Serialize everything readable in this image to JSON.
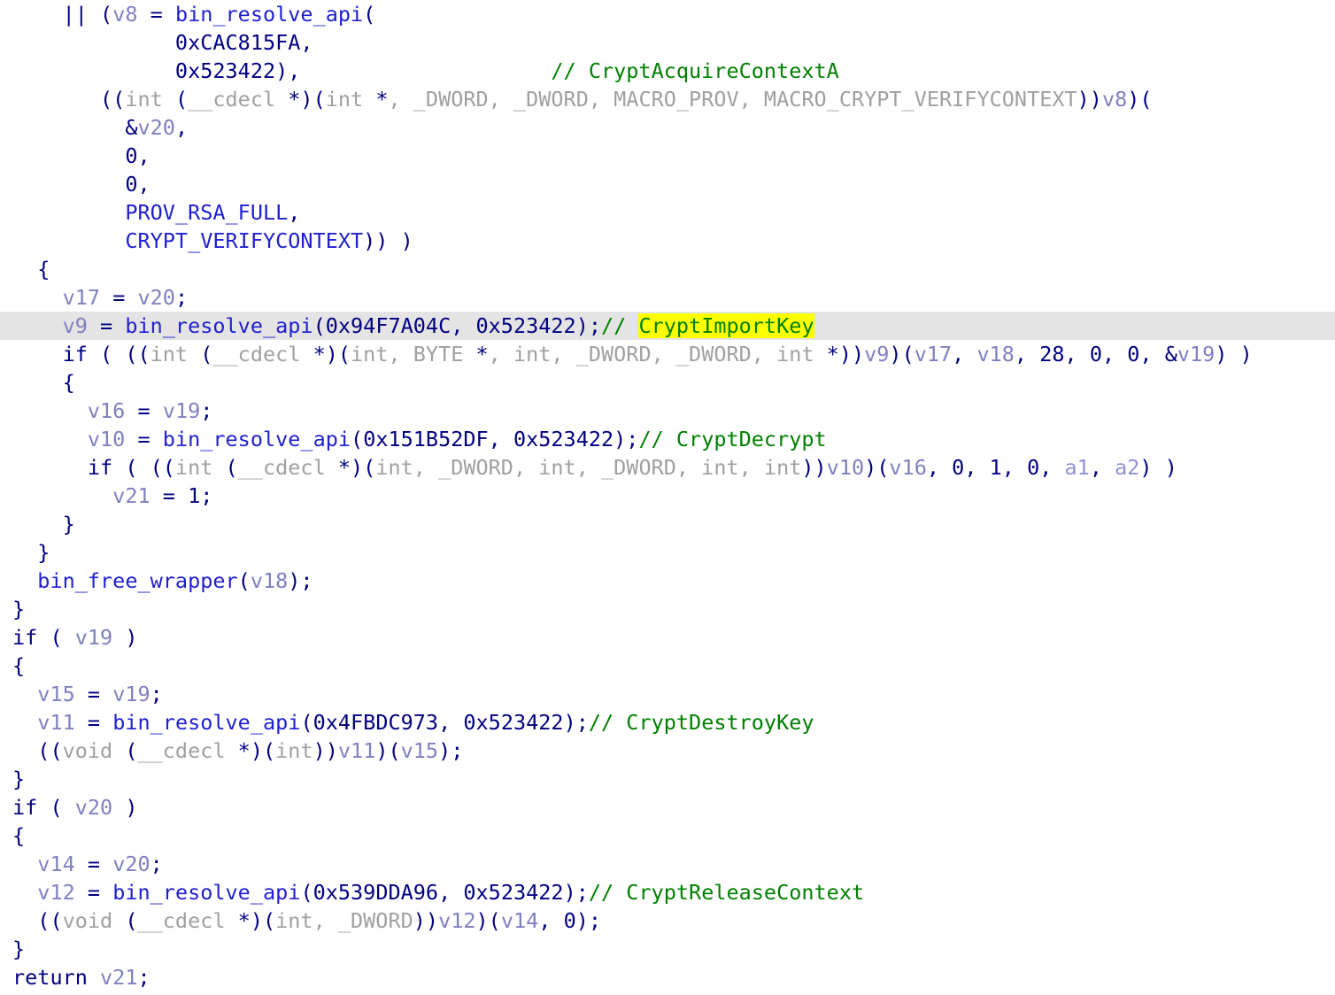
{
  "view": {
    "name": "ida-pseudocode-view",
    "background": "#ffffff",
    "current_line_background": "#e4e4e4",
    "highlight_background": "#ffff00",
    "font_size_px": 23.5,
    "line_height_px": 32
  },
  "colors": {
    "keyword": "#000080",
    "function": "#2020d0",
    "variable": "#8080c0",
    "argument": "#9090d8",
    "type": "#a0a0a0",
    "comment": "#008000",
    "macro": "#2020d0",
    "highlight_bg": "#ffff00",
    "current_line_bg": "#e4e4e4"
  },
  "lines": [
    {
      "index": 0,
      "current": false,
      "tokens": [
        {
          "cls": "t-punct",
          "text": "    || ("
        },
        {
          "cls": "t-var",
          "text": "v8"
        },
        {
          "cls": "t-punct",
          "text": " = "
        },
        {
          "cls": "t-fn",
          "text": "bin_resolve_api"
        },
        {
          "cls": "t-punct",
          "text": "("
        }
      ]
    },
    {
      "index": 1,
      "current": false,
      "tokens": [
        {
          "cls": "t-num",
          "text": "             0xCAC815FA,"
        }
      ]
    },
    {
      "index": 2,
      "current": false,
      "tokens": [
        {
          "cls": "t-num",
          "text": "             0x523422),"
        },
        {
          "cls": "t-cmt",
          "text": "                    // CryptAcquireContextA"
        }
      ]
    },
    {
      "index": 3,
      "current": false,
      "tokens": [
        {
          "cls": "t-punct",
          "text": "       (("
        },
        {
          "cls": "t-type",
          "text": "int"
        },
        {
          "cls": "t-punct",
          "text": " ("
        },
        {
          "cls": "t-type",
          "text": "__cdecl"
        },
        {
          "cls": "t-punct",
          "text": " *)("
        },
        {
          "cls": "t-type",
          "text": "int"
        },
        {
          "cls": "t-punct",
          "text": " *"
        },
        {
          "cls": "t-type",
          "text": ", _DWORD, _DWORD, MACRO_PROV, MACRO_CRYPT_VERIFYCONTEXT"
        },
        {
          "cls": "t-punct",
          "text": "))"
        },
        {
          "cls": "t-var",
          "text": "v8"
        },
        {
          "cls": "t-punct",
          "text": ")("
        }
      ]
    },
    {
      "index": 4,
      "current": false,
      "tokens": [
        {
          "cls": "t-punct",
          "text": "         &"
        },
        {
          "cls": "t-var",
          "text": "v20"
        },
        {
          "cls": "t-punct",
          "text": ","
        }
      ]
    },
    {
      "index": 5,
      "current": false,
      "tokens": [
        {
          "cls": "t-num",
          "text": "         0,"
        }
      ]
    },
    {
      "index": 6,
      "current": false,
      "tokens": [
        {
          "cls": "t-num",
          "text": "         0,"
        }
      ]
    },
    {
      "index": 7,
      "current": false,
      "tokens": [
        {
          "cls": "t-macro",
          "text": "         PROV_RSA_FULL"
        },
        {
          "cls": "t-punct",
          "text": ","
        }
      ]
    },
    {
      "index": 8,
      "current": false,
      "tokens": [
        {
          "cls": "t-macro",
          "text": "         CRYPT_VERIFYCONTEXT"
        },
        {
          "cls": "t-punct",
          "text": ")) )"
        }
      ]
    },
    {
      "index": 9,
      "current": false,
      "tokens": [
        {
          "cls": "t-punct",
          "text": "  {"
        }
      ]
    },
    {
      "index": 10,
      "current": false,
      "tokens": [
        {
          "cls": "t-var",
          "text": "    v17"
        },
        {
          "cls": "t-punct",
          "text": " = "
        },
        {
          "cls": "t-var",
          "text": "v20"
        },
        {
          "cls": "t-punct",
          "text": ";"
        }
      ]
    },
    {
      "index": 11,
      "current": true,
      "tokens": [
        {
          "cls": "t-var",
          "text": "    v9"
        },
        {
          "cls": "t-punct",
          "text": " = "
        },
        {
          "cls": "t-fn",
          "text": "bin_resolve_api"
        },
        {
          "cls": "t-punct",
          "text": "("
        },
        {
          "cls": "t-num",
          "text": "0x94F7A04C"
        },
        {
          "cls": "t-punct",
          "text": ", "
        },
        {
          "cls": "t-num",
          "text": "0x523422"
        },
        {
          "cls": "t-punct",
          "text": ");"
        },
        {
          "cls": "t-cmt",
          "text": "// "
        },
        {
          "cls": "t-hl",
          "text": "CryptImportKey"
        }
      ]
    },
    {
      "index": 12,
      "current": false,
      "tokens": [
        {
          "cls": "t-kw",
          "text": "    if"
        },
        {
          "cls": "t-punct",
          "text": " ( (("
        },
        {
          "cls": "t-type",
          "text": "int"
        },
        {
          "cls": "t-punct",
          "text": " ("
        },
        {
          "cls": "t-type",
          "text": "__cdecl"
        },
        {
          "cls": "t-punct",
          "text": " *)("
        },
        {
          "cls": "t-type",
          "text": "int, BYTE"
        },
        {
          "cls": "t-punct",
          "text": " *"
        },
        {
          "cls": "t-type",
          "text": ", int, _DWORD, _DWORD, int"
        },
        {
          "cls": "t-punct",
          "text": " *))"
        },
        {
          "cls": "t-var",
          "text": "v9"
        },
        {
          "cls": "t-punct",
          "text": ")("
        },
        {
          "cls": "t-var",
          "text": "v17"
        },
        {
          "cls": "t-punct",
          "text": ", "
        },
        {
          "cls": "t-var",
          "text": "v18"
        },
        {
          "cls": "t-punct",
          "text": ", "
        },
        {
          "cls": "t-num",
          "text": "28"
        },
        {
          "cls": "t-punct",
          "text": ", "
        },
        {
          "cls": "t-num",
          "text": "0"
        },
        {
          "cls": "t-punct",
          "text": ", "
        },
        {
          "cls": "t-num",
          "text": "0"
        },
        {
          "cls": "t-punct",
          "text": ", &"
        },
        {
          "cls": "t-var",
          "text": "v19"
        },
        {
          "cls": "t-punct",
          "text": ") )"
        }
      ]
    },
    {
      "index": 13,
      "current": false,
      "tokens": [
        {
          "cls": "t-punct",
          "text": "    {"
        }
      ]
    },
    {
      "index": 14,
      "current": false,
      "tokens": [
        {
          "cls": "t-var",
          "text": "      v16"
        },
        {
          "cls": "t-punct",
          "text": " = "
        },
        {
          "cls": "t-var",
          "text": "v19"
        },
        {
          "cls": "t-punct",
          "text": ";"
        }
      ]
    },
    {
      "index": 15,
      "current": false,
      "tokens": [
        {
          "cls": "t-var",
          "text": "      v10"
        },
        {
          "cls": "t-punct",
          "text": " = "
        },
        {
          "cls": "t-fn",
          "text": "bin_resolve_api"
        },
        {
          "cls": "t-punct",
          "text": "("
        },
        {
          "cls": "t-num",
          "text": "0x151B52DF"
        },
        {
          "cls": "t-punct",
          "text": ", "
        },
        {
          "cls": "t-num",
          "text": "0x523422"
        },
        {
          "cls": "t-punct",
          "text": ");"
        },
        {
          "cls": "t-cmt",
          "text": "// CryptDecrypt"
        }
      ]
    },
    {
      "index": 16,
      "current": false,
      "tokens": [
        {
          "cls": "t-kw",
          "text": "      if"
        },
        {
          "cls": "t-punct",
          "text": " ( (("
        },
        {
          "cls": "t-type",
          "text": "int"
        },
        {
          "cls": "t-punct",
          "text": " ("
        },
        {
          "cls": "t-type",
          "text": "__cdecl"
        },
        {
          "cls": "t-punct",
          "text": " *)("
        },
        {
          "cls": "t-type",
          "text": "int, _DWORD, int, _DWORD, int, int"
        },
        {
          "cls": "t-punct",
          "text": "))"
        },
        {
          "cls": "t-var",
          "text": "v10"
        },
        {
          "cls": "t-punct",
          "text": ")("
        },
        {
          "cls": "t-var",
          "text": "v16"
        },
        {
          "cls": "t-punct",
          "text": ", "
        },
        {
          "cls": "t-num",
          "text": "0"
        },
        {
          "cls": "t-punct",
          "text": ", "
        },
        {
          "cls": "t-num",
          "text": "1"
        },
        {
          "cls": "t-punct",
          "text": ", "
        },
        {
          "cls": "t-num",
          "text": "0"
        },
        {
          "cls": "t-punct",
          "text": ", "
        },
        {
          "cls": "t-arg",
          "text": "a1"
        },
        {
          "cls": "t-punct",
          "text": ", "
        },
        {
          "cls": "t-arg",
          "text": "a2"
        },
        {
          "cls": "t-punct",
          "text": ") )"
        }
      ]
    },
    {
      "index": 17,
      "current": false,
      "tokens": [
        {
          "cls": "t-var",
          "text": "        v21"
        },
        {
          "cls": "t-punct",
          "text": " = "
        },
        {
          "cls": "t-num",
          "text": "1"
        },
        {
          "cls": "t-punct",
          "text": ";"
        }
      ]
    },
    {
      "index": 18,
      "current": false,
      "tokens": [
        {
          "cls": "t-punct",
          "text": "    }"
        }
      ]
    },
    {
      "index": 19,
      "current": false,
      "tokens": [
        {
          "cls": "t-punct",
          "text": "  }"
        }
      ]
    },
    {
      "index": 20,
      "current": false,
      "tokens": [
        {
          "cls": "t-fn",
          "text": "  bin_free_wrapper"
        },
        {
          "cls": "t-punct",
          "text": "("
        },
        {
          "cls": "t-var",
          "text": "v18"
        },
        {
          "cls": "t-punct",
          "text": ");"
        }
      ]
    },
    {
      "index": 21,
      "current": false,
      "tokens": [
        {
          "cls": "t-punct",
          "text": "}"
        }
      ]
    },
    {
      "index": 22,
      "current": false,
      "tokens": [
        {
          "cls": "t-kw",
          "text": "if"
        },
        {
          "cls": "t-punct",
          "text": " ( "
        },
        {
          "cls": "t-var",
          "text": "v19"
        },
        {
          "cls": "t-punct",
          "text": " )"
        }
      ]
    },
    {
      "index": 23,
      "current": false,
      "tokens": [
        {
          "cls": "t-punct",
          "text": "{"
        }
      ]
    },
    {
      "index": 24,
      "current": false,
      "tokens": [
        {
          "cls": "t-var",
          "text": "  v15"
        },
        {
          "cls": "t-punct",
          "text": " = "
        },
        {
          "cls": "t-var",
          "text": "v19"
        },
        {
          "cls": "t-punct",
          "text": ";"
        }
      ]
    },
    {
      "index": 25,
      "current": false,
      "tokens": [
        {
          "cls": "t-var",
          "text": "  v11"
        },
        {
          "cls": "t-punct",
          "text": " = "
        },
        {
          "cls": "t-fn",
          "text": "bin_resolve_api"
        },
        {
          "cls": "t-punct",
          "text": "("
        },
        {
          "cls": "t-num",
          "text": "0x4FBDC973"
        },
        {
          "cls": "t-punct",
          "text": ", "
        },
        {
          "cls": "t-num",
          "text": "0x523422"
        },
        {
          "cls": "t-punct",
          "text": ");"
        },
        {
          "cls": "t-cmt",
          "text": "// CryptDestroyKey"
        }
      ]
    },
    {
      "index": 26,
      "current": false,
      "tokens": [
        {
          "cls": "t-punct",
          "text": "  (("
        },
        {
          "cls": "t-type",
          "text": "void"
        },
        {
          "cls": "t-punct",
          "text": " ("
        },
        {
          "cls": "t-type",
          "text": "__cdecl"
        },
        {
          "cls": "t-punct",
          "text": " *)("
        },
        {
          "cls": "t-type",
          "text": "int"
        },
        {
          "cls": "t-punct",
          "text": "))"
        },
        {
          "cls": "t-var",
          "text": "v11"
        },
        {
          "cls": "t-punct",
          "text": ")("
        },
        {
          "cls": "t-var",
          "text": "v15"
        },
        {
          "cls": "t-punct",
          "text": ");"
        }
      ]
    },
    {
      "index": 27,
      "current": false,
      "tokens": [
        {
          "cls": "t-punct",
          "text": "}"
        }
      ]
    },
    {
      "index": 28,
      "current": false,
      "tokens": [
        {
          "cls": "t-kw",
          "text": "if"
        },
        {
          "cls": "t-punct",
          "text": " ( "
        },
        {
          "cls": "t-var",
          "text": "v20"
        },
        {
          "cls": "t-punct",
          "text": " )"
        }
      ]
    },
    {
      "index": 29,
      "current": false,
      "tokens": [
        {
          "cls": "t-punct",
          "text": "{"
        }
      ]
    },
    {
      "index": 30,
      "current": false,
      "tokens": [
        {
          "cls": "t-var",
          "text": "  v14"
        },
        {
          "cls": "t-punct",
          "text": " = "
        },
        {
          "cls": "t-var",
          "text": "v20"
        },
        {
          "cls": "t-punct",
          "text": ";"
        }
      ]
    },
    {
      "index": 31,
      "current": false,
      "tokens": [
        {
          "cls": "t-var",
          "text": "  v12"
        },
        {
          "cls": "t-punct",
          "text": " = "
        },
        {
          "cls": "t-fn",
          "text": "bin_resolve_api"
        },
        {
          "cls": "t-punct",
          "text": "("
        },
        {
          "cls": "t-num",
          "text": "0x539DDA96"
        },
        {
          "cls": "t-punct",
          "text": ", "
        },
        {
          "cls": "t-num",
          "text": "0x523422"
        },
        {
          "cls": "t-punct",
          "text": ");"
        },
        {
          "cls": "t-cmt",
          "text": "// CryptReleaseContext"
        }
      ]
    },
    {
      "index": 32,
      "current": false,
      "tokens": [
        {
          "cls": "t-punct",
          "text": "  (("
        },
        {
          "cls": "t-type",
          "text": "void"
        },
        {
          "cls": "t-punct",
          "text": " ("
        },
        {
          "cls": "t-type",
          "text": "__cdecl"
        },
        {
          "cls": "t-punct",
          "text": " *)("
        },
        {
          "cls": "t-type",
          "text": "int, _DWORD"
        },
        {
          "cls": "t-punct",
          "text": "))"
        },
        {
          "cls": "t-var",
          "text": "v12"
        },
        {
          "cls": "t-punct",
          "text": ")("
        },
        {
          "cls": "t-var",
          "text": "v14"
        },
        {
          "cls": "t-punct",
          "text": ", "
        },
        {
          "cls": "t-num",
          "text": "0"
        },
        {
          "cls": "t-punct",
          "text": ");"
        }
      ]
    },
    {
      "index": 33,
      "current": false,
      "tokens": [
        {
          "cls": "t-punct",
          "text": "}"
        }
      ]
    },
    {
      "index": 34,
      "current": false,
      "tokens": [
        {
          "cls": "t-kw",
          "text": "return"
        },
        {
          "cls": "t-punct",
          "text": " "
        },
        {
          "cls": "t-var",
          "text": "v21"
        },
        {
          "cls": "t-punct",
          "text": ";"
        }
      ]
    }
  ]
}
